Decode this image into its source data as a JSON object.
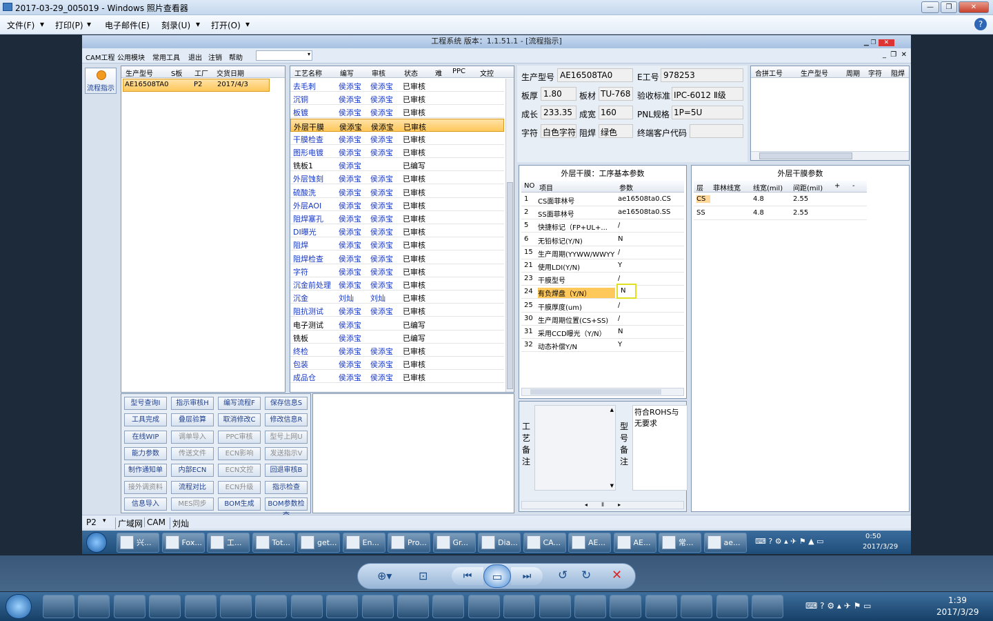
{
  "viewer": {
    "title": "2017-03-29_005019 - Windows 照片查看器",
    "menu": [
      "文件(F)",
      "打印(P)",
      "电子邮件(E)",
      "刻录(U)",
      "打开(O)"
    ]
  },
  "app": {
    "title": "工程系统  版本：1.1.51.1 - [流程指示]",
    "menu": [
      "CAM工程",
      "公用模块",
      "常用工具",
      "退出",
      "注销",
      "帮助"
    ],
    "sidebar_button": "流程指示",
    "products": {
      "headers": [
        "生产型号",
        "S板",
        "工厂",
        "交货日期"
      ],
      "rows": [
        [
          "AE16508TA0",
          "",
          "P2",
          "2017/4/3"
        ]
      ]
    },
    "process": {
      "headers": [
        "工艺名称",
        "编写",
        "审核",
        "状态",
        "难",
        "PPC",
        "文控"
      ],
      "rows": [
        [
          "去毛刺",
          "侯添宝",
          "侯添宝",
          "已审核"
        ],
        [
          "沉铜",
          "侯添宝",
          "侯添宝",
          "已审核"
        ],
        [
          "板镀",
          "侯添宝",
          "侯添宝",
          "已审核"
        ],
        [
          "外层干膜",
          "侯添宝",
          "侯添宝",
          "已审核"
        ],
        [
          "干膜检查",
          "侯添宝",
          "侯添宝",
          "已审核"
        ],
        [
          "图形电镀",
          "侯添宝",
          "侯添宝",
          "已审核"
        ],
        [
          "铣板1",
          "侯添宝",
          "",
          "已编写"
        ],
        [
          "外层蚀刻",
          "侯添宝",
          "侯添宝",
          "已审核"
        ],
        [
          "硫酸洗",
          "侯添宝",
          "侯添宝",
          "已审核"
        ],
        [
          "外层AOI",
          "侯添宝",
          "侯添宝",
          "已审核"
        ],
        [
          "阻焊塞孔",
          "侯添宝",
          "侯添宝",
          "已审核"
        ],
        [
          "DI曝光",
          "侯添宝",
          "侯添宝",
          "已审核"
        ],
        [
          "阻焊",
          "侯添宝",
          "侯添宝",
          "已审核"
        ],
        [
          "阻焊检查",
          "侯添宝",
          "侯添宝",
          "已审核"
        ],
        [
          "字符",
          "侯添宝",
          "侯添宝",
          "已审核"
        ],
        [
          "沉金前处理",
          "侯添宝",
          "侯添宝",
          "已审核"
        ],
        [
          "沉金",
          "刘灿",
          "刘灿",
          "已审核"
        ],
        [
          "阻抗测试",
          "侯添宝",
          "侯添宝",
          "已审核"
        ],
        [
          "电子测试",
          "侯添宝",
          "",
          "已编写"
        ],
        [
          "铣板",
          "侯添宝",
          "",
          "已编写"
        ],
        [
          "终检",
          "侯添宝",
          "侯添宝",
          "已审核"
        ],
        [
          "包装",
          "侯添宝",
          "侯添宝",
          "已审核"
        ],
        [
          "成品仓",
          "侯添宝",
          "侯添宝",
          "已审核"
        ]
      ]
    },
    "info": {
      "model_label": "生产型号",
      "model": "AE16508TA0",
      "eno_label": "E工号",
      "eno": "978253",
      "thick_label": "板厚",
      "thick": "1.80",
      "mat_label": "板材",
      "mat": "TU-768",
      "std_label": "验收标准",
      "std": "IPC-6012 Ⅱ级",
      "len_label": "成长",
      "len": "233.35",
      "wid_label": "成宽",
      "wid": "160",
      "pnl_label": "PNL规格",
      "pnl": "1P=5U",
      "char_label": "字符",
      "char": "白色字符",
      "mask_label": "阻焊",
      "mask": "绿色",
      "cust_label": "终端客户代码"
    },
    "combine": {
      "headers": [
        "合拼工号",
        "生产型号",
        "周期",
        "字符",
        "阻焊"
      ]
    },
    "params": {
      "title": "外层干膜：工序基本参数",
      "headers": [
        "NO",
        "项目",
        "参数"
      ],
      "rows": [
        [
          "1",
          "CS面菲林号",
          "ae16508ta0.CS"
        ],
        [
          "2",
          "SS面菲林号",
          "ae16508ta0.SS"
        ],
        [
          "5",
          "快捷标记（FP+UL+...",
          "/"
        ],
        [
          "6",
          "无铅标记(Y/N)",
          "N"
        ],
        [
          "15",
          "生产周期(YYWW/WWYY)",
          "/"
        ],
        [
          "21",
          "使用LDI(Y/N)",
          "Y"
        ],
        [
          "23",
          "干膜型号",
          "/"
        ],
        [
          "24",
          "有负焊盘（Y/N）",
          "N"
        ],
        [
          "25",
          "干膜厚度(um)",
          "/"
        ],
        [
          "30",
          "生产周期位置(CS+SS)",
          "/"
        ],
        [
          "31",
          "采用CCD曝光（Y/N）",
          "N"
        ],
        [
          "32",
          "动态补偿Y/N",
          "Y"
        ]
      ]
    },
    "film": {
      "title": "外层干膜参数",
      "headers": [
        "层",
        "菲林线宽",
        "线宽(mil)",
        "间距(mil)",
        "+",
        "-"
      ],
      "rows": [
        [
          "CS",
          "",
          "4.8",
          "2.55"
        ],
        [
          "SS",
          "",
          "4.8",
          "2.55"
        ]
      ]
    },
    "buttons": [
      [
        "型号查询I",
        "指示审核H",
        "编写流程F",
        "保存信息S"
      ],
      [
        "工具完成",
        "叠层验算",
        "取消修改C",
        "修改信息R"
      ],
      [
        "在线WIP",
        "调单导入",
        "PPC审核",
        "型号上网U"
      ],
      [
        "能力参数",
        "传送文件",
        "ECN影响",
        "发送指示V"
      ],
      [
        "制作通知单",
        "内部ECN",
        "ECN文控",
        "回退审核B"
      ],
      [
        "接外调资料",
        "流程对比",
        "ECN升级",
        "指示检查"
      ],
      [
        "信息导入",
        "MES同步",
        "BOM生成",
        "BOM参数检查"
      ]
    ],
    "remark_label": "工艺备注",
    "model_remark_label": "型号备注",
    "model_remark": "符合ROHS与无要求",
    "status": {
      "plant": "P2",
      "net": "广域网",
      "mode": "CAM",
      "user": "刘灿"
    },
    "inner_taskbar": {
      "items": [
        "兴...",
        "Fox...",
        "工...",
        "Tot...",
        "get...",
        "En...",
        "Pro...",
        "Gr...",
        "Dia...",
        "CA...",
        "AE...",
        "AE...",
        "常...",
        "ae..."
      ],
      "time": "0:50",
      "date": "2017/3/29"
    }
  },
  "taskbar": {
    "time": "1:39",
    "date": "2017/3/29"
  },
  "colors": {
    "accent": "#1637c8",
    "selection": "#ffc85a",
    "taskbar": "#1f4d7a"
  }
}
